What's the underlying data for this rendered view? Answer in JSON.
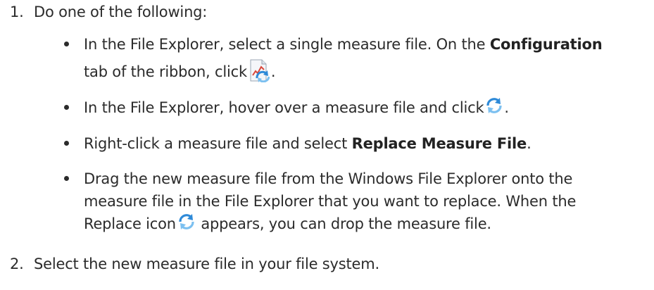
{
  "step1": {
    "number": "1.",
    "text": "Do one of the following:"
  },
  "bullets": [
    {
      "line1_pre": "In the File Explorer, select a single measure file. On the ",
      "line1_bold": "Configuration",
      "line2_pre": "tab of the ribbon, click",
      "line2_post": ".",
      "icon": "replace-measure-file-icon"
    },
    {
      "line1_pre": "In the File Explorer, hover over a measure file and click",
      "line1_post": ".",
      "icon": "replace-arrows-icon"
    },
    {
      "line1_pre": "Right-click a measure file and select ",
      "line1_bold": "Replace Measure File",
      "line1_post": "."
    },
    {
      "line1": "Drag the new measure file from the Windows File Explorer onto the",
      "line2": "measure file in the File Explorer that you want to replace. When the",
      "line3_pre": "Replace icon",
      "line3_post": " appears, you can drop the measure file.",
      "icon": "replace-arrows-icon"
    }
  ],
  "step2": {
    "number": "2.",
    "text": "Select the new measure file in your file system."
  },
  "colors": {
    "text": "#2b2b2b",
    "icon_blue": "#2e8ad8",
    "icon_light_blue": "#7cc0f0",
    "icon_red": "#d9473b"
  }
}
